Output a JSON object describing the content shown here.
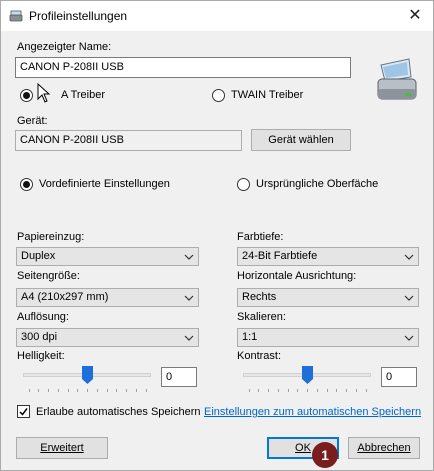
{
  "window": {
    "title": "Profileinstellungen",
    "close_glyph": "✕"
  },
  "device_name": {
    "label": "Angezeigter Name:",
    "value": "CANON P-208II USB"
  },
  "driver": {
    "option_isis": "A Treiber",
    "option_twain": "TWAIN Treiber",
    "selected": "isis"
  },
  "device": {
    "label": "Gerät:",
    "value": "CANON P-208II USB",
    "select_button": "Gerät wählen"
  },
  "settings_mode": {
    "predefined": "Vordefinierte Einstellungen",
    "original_ui": "Ursprüngliche Oberfäche",
    "selected": "predefined"
  },
  "paper_feed": {
    "label": "Papiereinzug:",
    "value": "Duplex"
  },
  "color_depth": {
    "label": "Farbtiefe:",
    "value": "24-Bit Farbtiefe"
  },
  "page_size": {
    "label": "Seitengröße:",
    "value": "A4 (210x297 mm)"
  },
  "h_align": {
    "label": "Horizontale Ausrichtung:",
    "value": "Rechts"
  },
  "resolution": {
    "label": "Auflösung:",
    "value": "300 dpi"
  },
  "scaling": {
    "label": "Skalieren:",
    "value": "1:1"
  },
  "brightness": {
    "label": "Helligkeit:",
    "value": "0",
    "level": 0.5
  },
  "contrast": {
    "label": "Kontrast:",
    "value": "0",
    "level": 0.5
  },
  "autosave": {
    "checkbox_label": "Erlaube automatisches Speichern",
    "checked": true,
    "link": "Einstellungen zum automatischen Speichern"
  },
  "buttons": {
    "advanced": "Erweitert",
    "ok": "OK",
    "cancel": "Abbrechen"
  },
  "callout_badge": "1",
  "colors": {
    "accent": "#0078d7",
    "thumb": "#1e6fd9",
    "link": "#0066cc",
    "badge": "#7a1d1d"
  }
}
